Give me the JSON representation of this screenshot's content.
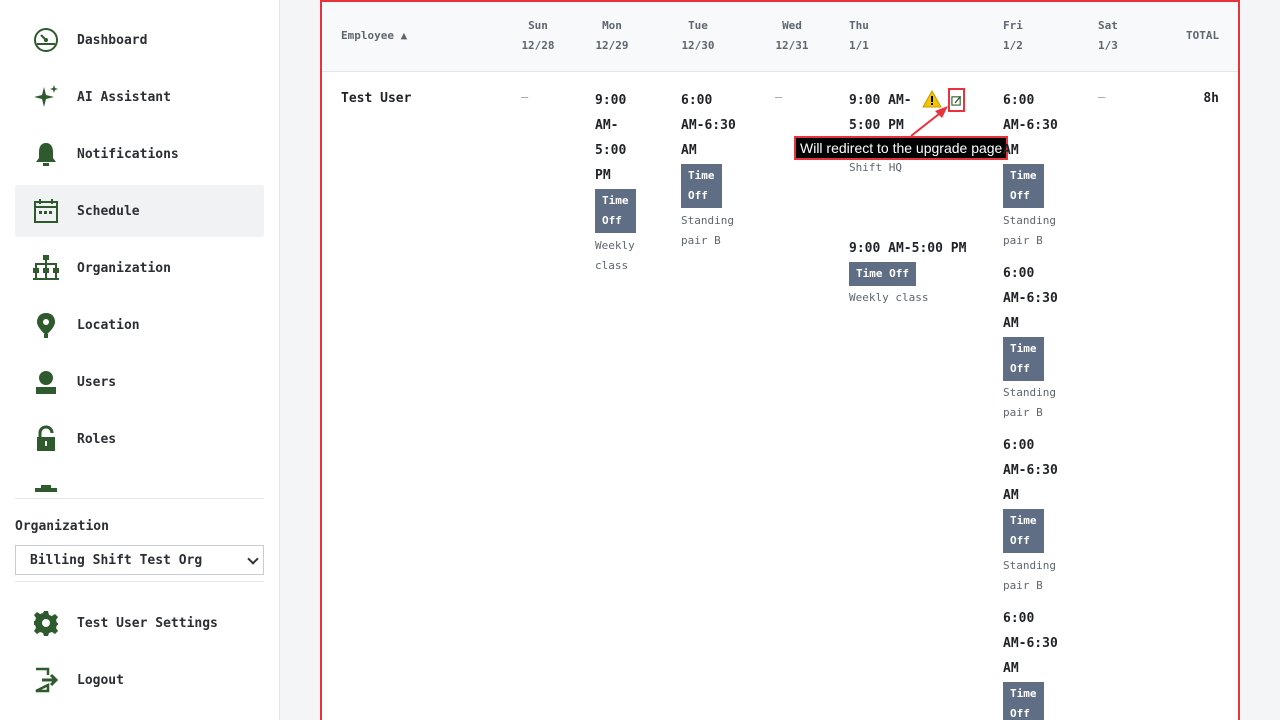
{
  "sidebar": {
    "items": [
      {
        "label": "Dashboard",
        "icon": "dashboard-icon"
      },
      {
        "label": "AI Assistant",
        "icon": "sparkle-icon"
      },
      {
        "label": "Notifications",
        "icon": "bell-icon"
      },
      {
        "label": "Schedule",
        "icon": "calendar-icon",
        "active": true
      },
      {
        "label": "Organization",
        "icon": "org-chart-icon"
      },
      {
        "label": "Location",
        "icon": "location-pin-icon"
      },
      {
        "label": "Users",
        "icon": "user-icon"
      },
      {
        "label": "Roles",
        "icon": "lock-icon"
      }
    ],
    "org_label": "Organization",
    "org_selected": "Billing Shift Test Org",
    "settings_label": "Test User Settings",
    "logout_label": "Logout"
  },
  "schedule": {
    "header": {
      "employee": "Employee ▲",
      "days": [
        {
          "name": "Sun",
          "date": "12/28"
        },
        {
          "name": "Mon",
          "date": "12/29"
        },
        {
          "name": "Tue",
          "date": "12/30"
        },
        {
          "name": "Wed",
          "date": "12/31"
        },
        {
          "name": "Thu",
          "date": "1/1"
        },
        {
          "name": "Fri",
          "date": "1/2"
        },
        {
          "name": "Sat",
          "date": "1/3"
        }
      ],
      "total": "TOTAL"
    },
    "row": {
      "name": "Test User",
      "dash": "–",
      "total": "8h",
      "mon": {
        "time": [
          "9:00",
          "AM-",
          "5:00",
          "PM"
        ],
        "badge": [
          "Time",
          "Off"
        ],
        "note": [
          "Weekly",
          "class"
        ]
      },
      "tue": {
        "time": [
          "6:00",
          "AM-6:30",
          "AM"
        ],
        "badge": [
          "Time",
          "Off"
        ],
        "note": [
          "Standing",
          "pair B"
        ]
      },
      "thu": {
        "shift1": {
          "time": [
            "9:00 AM-",
            "5:00 PM"
          ],
          "note": "Shift HQ"
        },
        "shift2": {
          "time": "9:00 AM-5:00 PM",
          "badge": "Time Off",
          "note": "Weekly class"
        }
      },
      "fri": {
        "time": [
          "6:00",
          "AM-6:30",
          "AM"
        ],
        "badge": [
          "Time",
          "Off"
        ],
        "note": [
          "Standing",
          "pair B"
        ]
      }
    },
    "tooltip": "Will redirect to the upgrade page"
  },
  "colors": {
    "accent_red": "#e8323c",
    "badge": "#5f6e84",
    "icon_green": "#2e5a2e"
  }
}
